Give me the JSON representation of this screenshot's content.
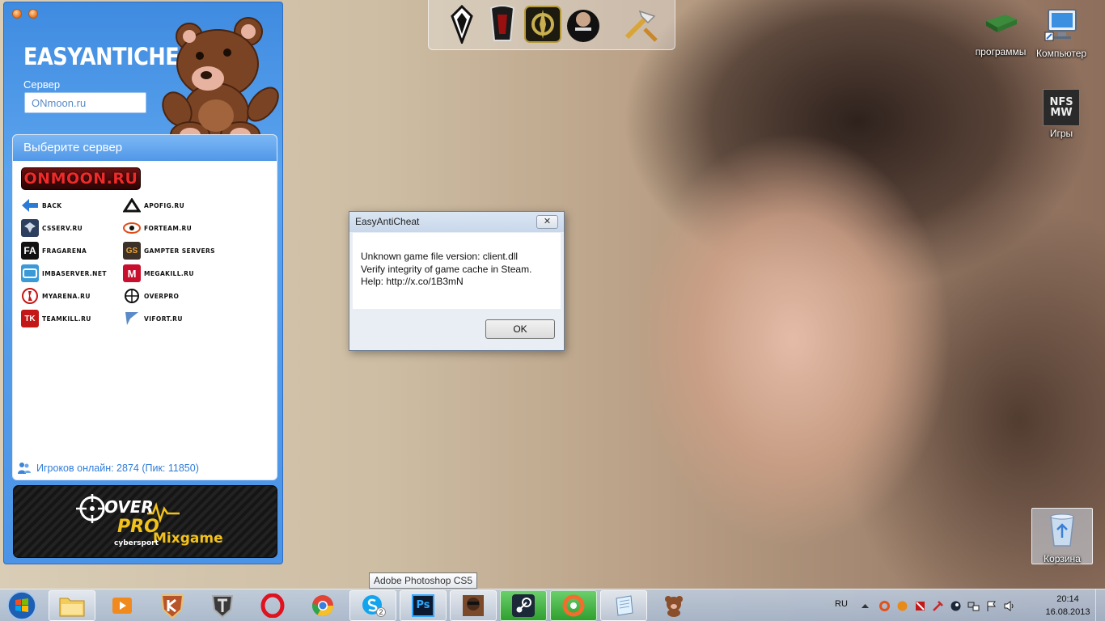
{
  "launcher": {
    "title": "EASYANTICHEAT",
    "server_label": "Сервер",
    "server_value": "ONmoon.ru",
    "panel_title": "Выберите сервер",
    "featured_logo": "ONMOON.RU",
    "servers_left": [
      {
        "name": "Back",
        "icon": "back-arrow-icon",
        "color": "#2a7bd6"
      },
      {
        "name": "csserv.ru",
        "icon": "csserv-icon",
        "color": "#2d3f5e"
      },
      {
        "name": "Fragarena",
        "icon": "fa-icon",
        "color": "#111111"
      },
      {
        "name": "imbaserver.net",
        "icon": "imba-icon",
        "color": "#3a9ad8"
      },
      {
        "name": "Myarena.ru",
        "icon": "myarena-icon",
        "color": "#ffffff"
      },
      {
        "name": "teamkill.ru",
        "icon": "teamkill-icon",
        "color": "#c41818"
      }
    ],
    "servers_right": [
      {
        "name": "Apofig.ru",
        "icon": "apofig-icon",
        "color": "#ffffff"
      },
      {
        "name": "forteam.ru",
        "icon": "forteam-icon",
        "color": "#ffffff"
      },
      {
        "name": "Gampter servers",
        "icon": "gampter-icon",
        "color": "#3b3128"
      },
      {
        "name": "megakill.ru",
        "icon": "megakill-icon",
        "color": "#c8102e"
      },
      {
        "name": "Overpro",
        "icon": "overpro-icon",
        "color": "#ffffff"
      },
      {
        "name": "vifort.ru",
        "icon": "vifort-icon",
        "color": "#ffffff"
      }
    ],
    "online_text": "Игроков онлайн: 2874 (Пик: 11850)",
    "banner": {
      "line1": "OVER",
      "line2": "PRO",
      "line3": "Mixgame",
      "line4": "cybersport"
    }
  },
  "dock": {
    "items": [
      "skyrim-icon",
      "oblivion-icon",
      "stalker-icon",
      "watch-dogs-icon",
      "tools-icon"
    ]
  },
  "desktop_icons": [
    {
      "label": "программы",
      "icon": "drive-icon"
    },
    {
      "label": "Компьютер",
      "icon": "computer-icon"
    },
    {
      "label": "Игры",
      "icon": "nfs-mw-icon",
      "icon_text": "NFS MW"
    },
    {
      "label": "Корзина",
      "icon": "recycle-bin-icon"
    }
  ],
  "dialog": {
    "title": "EasyAntiCheat",
    "close_glyph": "✕",
    "line1": "Unknown game file version: client.dll",
    "line2": "Verify integrity of game cache in Steam.",
    "line3": "Help: http://x.co/1B3mN",
    "ok_label": "OK"
  },
  "taskbar": {
    "tooltip": "Adobe Photoshop CS5",
    "lang": "RU",
    "time": "20:14",
    "date": "16.08.2013",
    "skype_badge": "2"
  }
}
